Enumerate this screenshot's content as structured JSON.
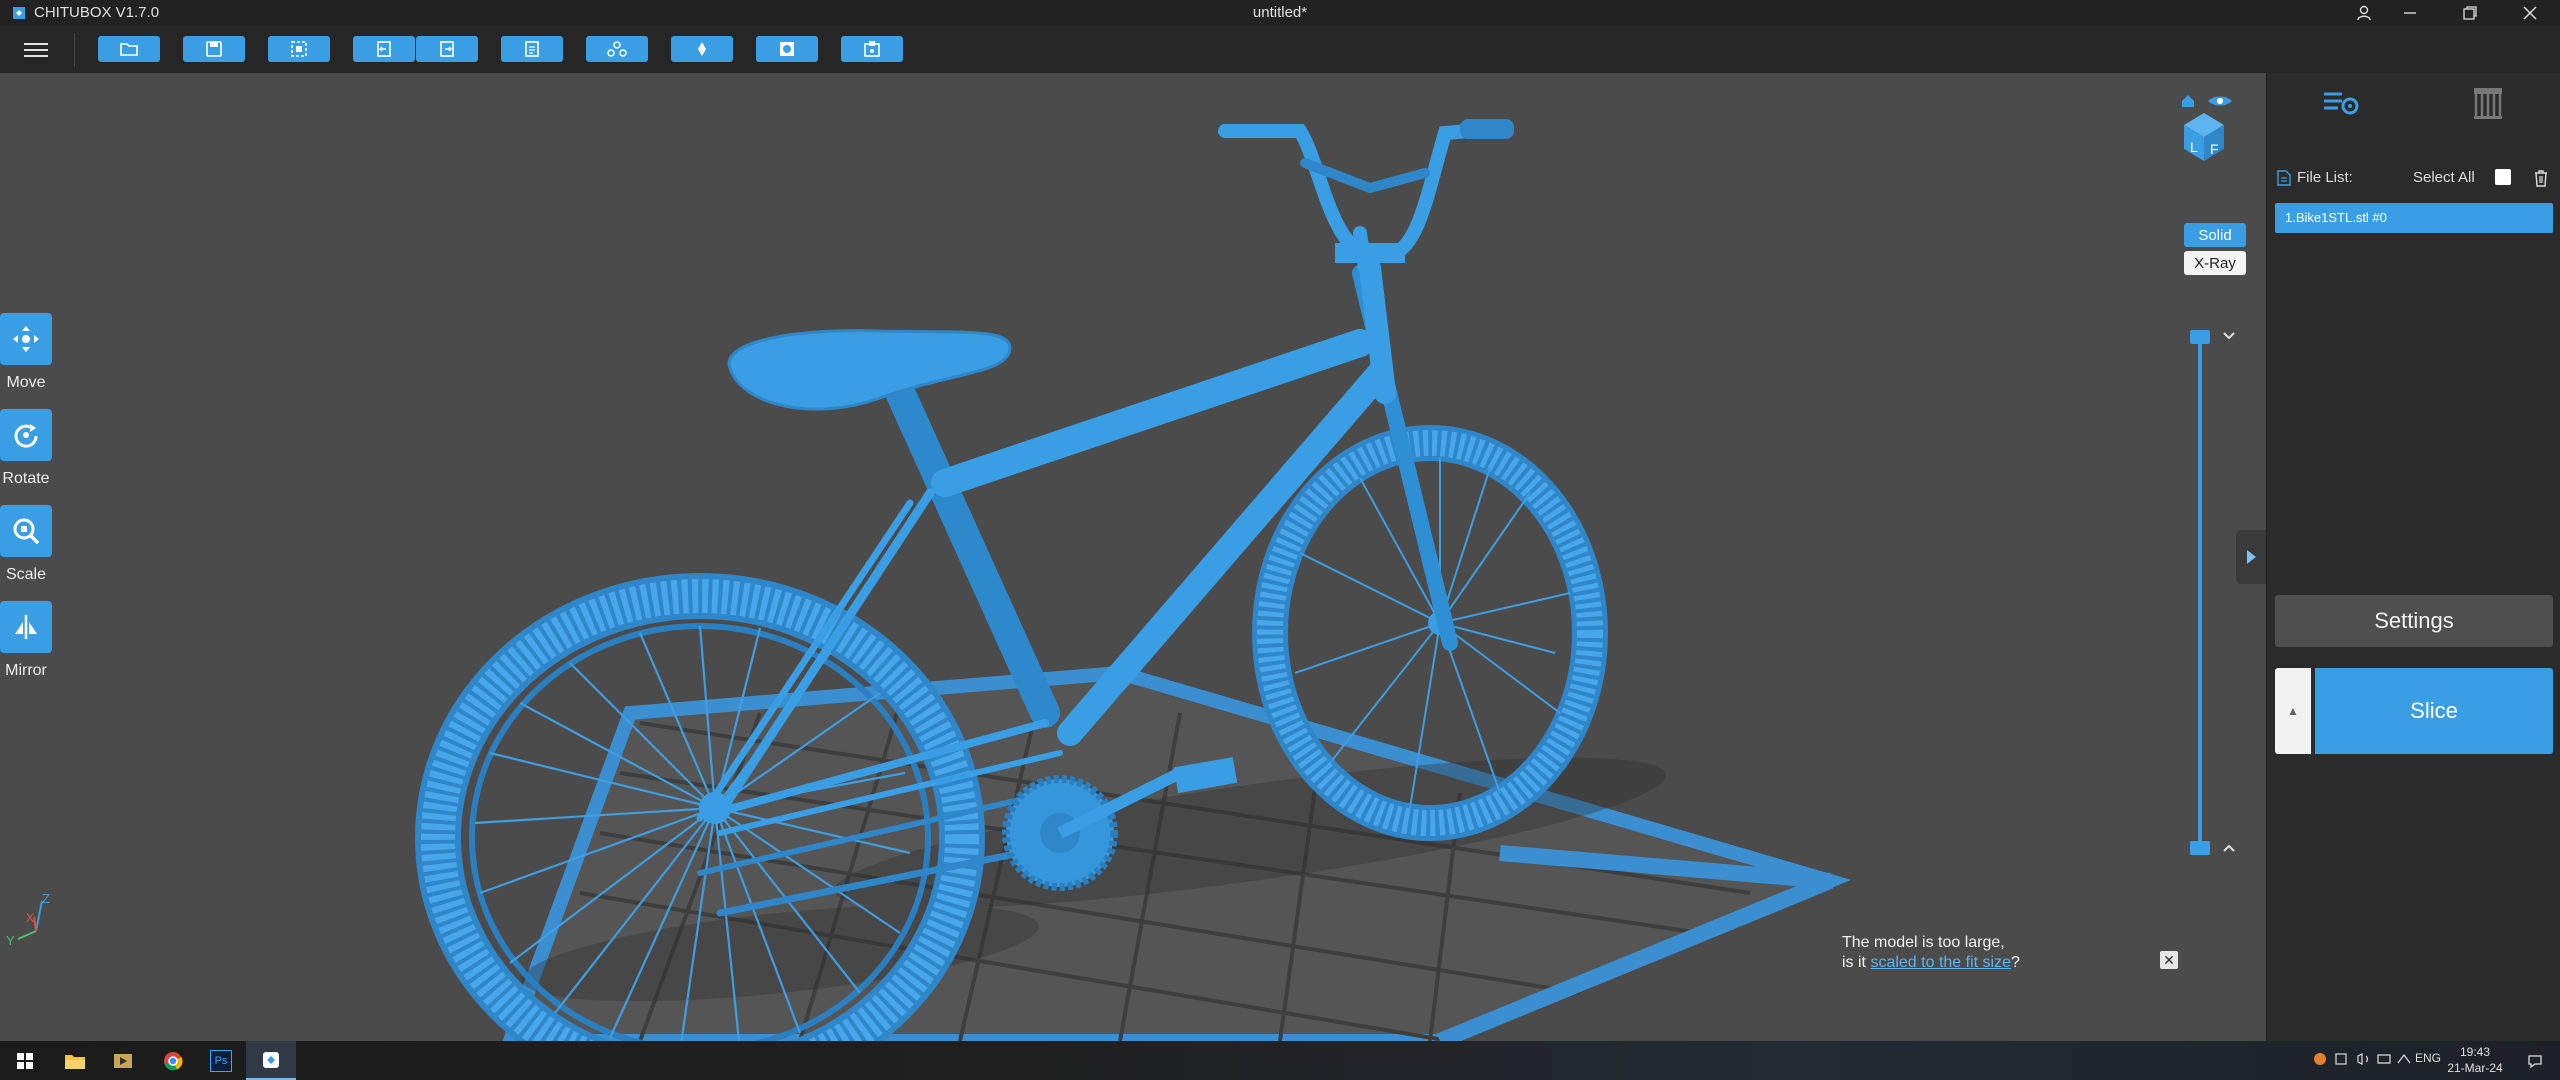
{
  "window": {
    "app_name": "CHITUBOX V1.7.0",
    "document_title": "untitled*"
  },
  "toolbar": {
    "buttons": [
      {
        "name": "open-file-button",
        "icon": "folder-icon"
      },
      {
        "name": "save-file-button",
        "icon": "save-icon"
      },
      {
        "name": "select-all-models-button",
        "icon": "select-icon"
      },
      {
        "name": "undo-button",
        "icon": "undo-icon"
      },
      {
        "name": "redo-button",
        "icon": "redo-icon"
      },
      {
        "name": "list-button",
        "icon": "list-icon"
      },
      {
        "name": "layout-button",
        "icon": "layout-icon"
      },
      {
        "name": "support-button",
        "icon": "support-icon"
      },
      {
        "name": "hollow-button",
        "icon": "hollow-icon"
      },
      {
        "name": "dig-hole-button",
        "icon": "dig-hole-icon"
      }
    ]
  },
  "left_tools": [
    {
      "label": "Move",
      "icon": "move-icon"
    },
    {
      "label": "Rotate",
      "icon": "rotate-icon"
    },
    {
      "label": "Scale",
      "icon": "scale-icon"
    },
    {
      "label": "Mirror",
      "icon": "mirror-icon"
    }
  ],
  "view_modes": {
    "solid": "Solid",
    "xray": "X-Ray",
    "active": "Solid"
  },
  "view_cube": {
    "labels": [
      "L",
      "F"
    ]
  },
  "axis_gizmo": {
    "x": "X",
    "y": "Y",
    "z": "Z"
  },
  "notice": {
    "line1": "The model is too large,",
    "line2_prefix": "is it ",
    "link": "scaled to the fit size",
    "line2_suffix": "?"
  },
  "right_panel": {
    "file_list_label": "File List:",
    "select_all_label": "Select All",
    "files": [
      "1.Bike1STL.stl #0"
    ],
    "settings_label": "Settings",
    "slice_label": "Slice"
  },
  "taskbar": {
    "apps": [
      "windows-start-icon",
      "file-explorer-icon",
      "media-player-icon",
      "chrome-icon",
      "photoshop-icon",
      "chitubox-icon"
    ],
    "ps_label": "Ps",
    "language": "ENG",
    "time": "19:43",
    "date": "21-Mar-24"
  },
  "colors": {
    "accent": "#3a9ee4",
    "model": "#3b9ade",
    "background": "#4b4b4b",
    "panel": "#2b2b2b"
  }
}
